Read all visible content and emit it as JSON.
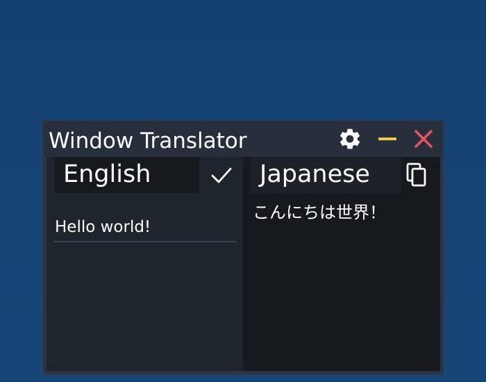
{
  "window": {
    "title": "Window Translator"
  },
  "titlebar_icons": {
    "settings": "gear-icon",
    "minimize": "minimize-icon",
    "close": "close-icon"
  },
  "source": {
    "language": "English",
    "text": "Hello world!",
    "confirm_icon": "check-icon"
  },
  "target": {
    "language": "Japanese",
    "text": "こんにちは世界！",
    "copy_icon": "copy-icon"
  },
  "colors": {
    "minimize": "#f5c84c",
    "close": "#e8545a",
    "icon": "#ffffff"
  }
}
